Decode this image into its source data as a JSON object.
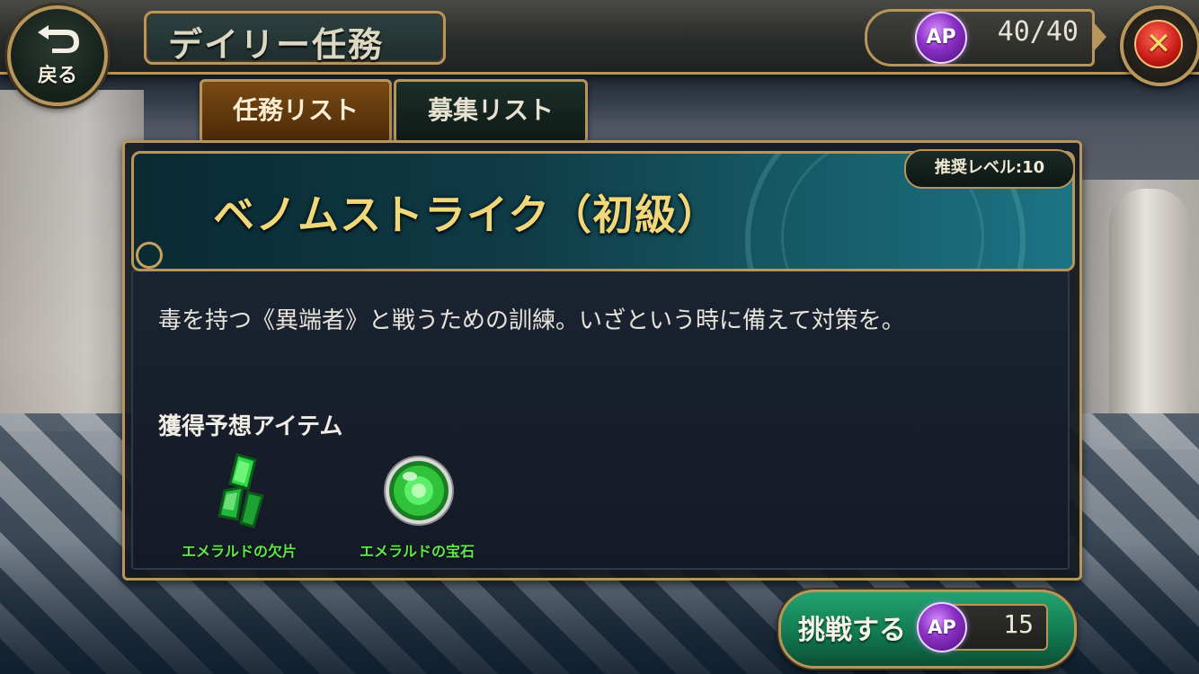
{
  "header": {
    "back_label": "戻る",
    "title": "デイリー任務",
    "ap_badge": "AP",
    "ap_value": "40/40"
  },
  "tabs": [
    {
      "label": "任務リスト",
      "active": true
    },
    {
      "label": "募集リスト",
      "active": false
    }
  ],
  "mission": {
    "name": "ベノムストライク（初級）",
    "recommended_level": "推奨レベル:10",
    "description": "毒を持つ《異端者》と戦うための訓練。いざという時に備えて対策を。",
    "rewards_heading": "獲得予想アイテム",
    "rewards": [
      {
        "name": "エメラルドの欠片",
        "icon": "emerald-shard-icon"
      },
      {
        "name": "エメラルドの宝石",
        "icon": "emerald-gem-icon"
      }
    ]
  },
  "challenge": {
    "label": "挑戦する",
    "ap_badge": "AP",
    "ap_cost": "15"
  },
  "colors": {
    "gold_trim": "#b8955a",
    "mission_title": "#f0d77a",
    "reward_label": "#5ee84a",
    "challenge_green": "#137a52",
    "ap_purple": "#8a2fc4"
  }
}
